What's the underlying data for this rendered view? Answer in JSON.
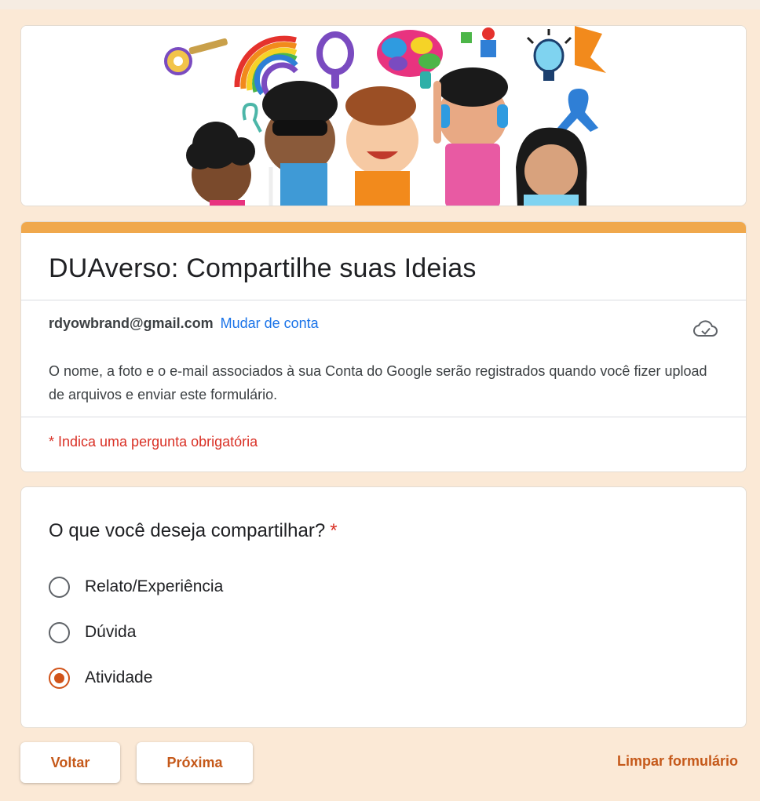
{
  "banner": {
    "icons": [
      "key-icon",
      "rainbow-icon",
      "balloon-icon",
      "brain-icon",
      "puzzle-person-icon",
      "lightbulb-icon",
      "awareness-ribbon-icon",
      "children-illustration"
    ]
  },
  "form": {
    "title": "DUAverso: Compartilhe suas Ideias",
    "account_email": "rdyowbrand@gmail.com",
    "switch_account_label": "Mudar de conta",
    "notice": "O nome, a foto e o e-mail associados à sua Conta do Google serão registrados quando você fizer upload de arquivos e enviar este formulário.",
    "required_note": "* Indica uma pergunta obrigatória"
  },
  "question": {
    "title": "O que você deseja compartilhar?",
    "required_mark": "*",
    "options": [
      {
        "label": "Relato/Experiência",
        "selected": false
      },
      {
        "label": "Dúvida",
        "selected": false
      },
      {
        "label": "Atividade",
        "selected": true
      }
    ]
  },
  "actions": {
    "back_label": "Voltar",
    "next_label": "Próxima",
    "clear_label": "Limpar formulário"
  },
  "colors": {
    "accent": "#f0a84c",
    "button_text": "#c5591a",
    "link": "#1a73e8",
    "required": "#d93025",
    "background": "#fbe9d6"
  }
}
